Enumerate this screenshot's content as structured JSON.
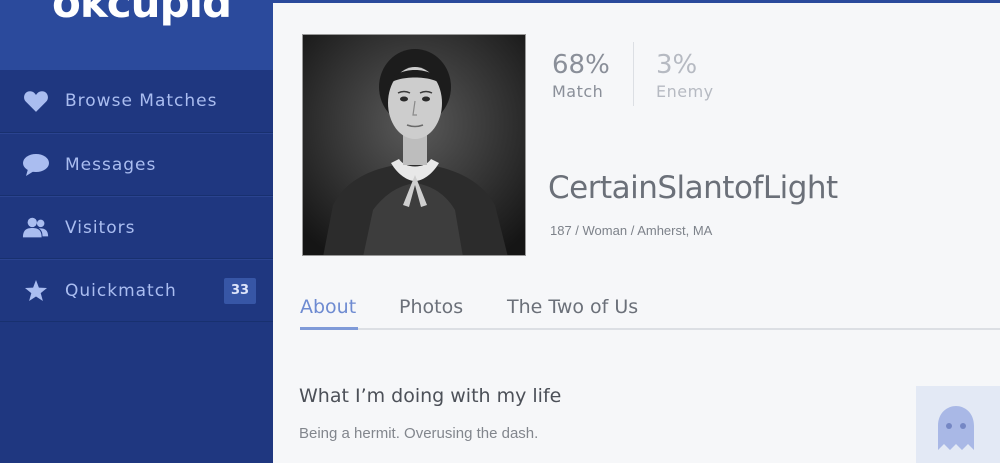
{
  "app": {
    "logo": "okcupid"
  },
  "sidebar": {
    "items": [
      {
        "label": "Browse Matches",
        "icon": "heart-icon"
      },
      {
        "label": "Messages",
        "icon": "speech-bubble-icon"
      },
      {
        "label": "Visitors",
        "icon": "people-icon"
      },
      {
        "label": "Quickmatch",
        "icon": "star-icon",
        "badge": "33"
      }
    ]
  },
  "profile": {
    "match_percent": "68%",
    "match_label": "Match",
    "enemy_percent": "3%",
    "enemy_label": "Enemy",
    "username": "CertainSlantofLight",
    "details": "187 / Woman / Amherst, MA"
  },
  "tabs": [
    {
      "label": "About",
      "active": true
    },
    {
      "label": "Photos",
      "active": false
    },
    {
      "label": "The Two of Us",
      "active": false
    }
  ],
  "essay": {
    "title": "What I’m doing with my life",
    "text": "Being a hermit. Overusing the dash."
  },
  "colors": {
    "sidebar": "#1f3780",
    "accent": "#7f9ad8",
    "nav_text": "#aabdf0"
  }
}
